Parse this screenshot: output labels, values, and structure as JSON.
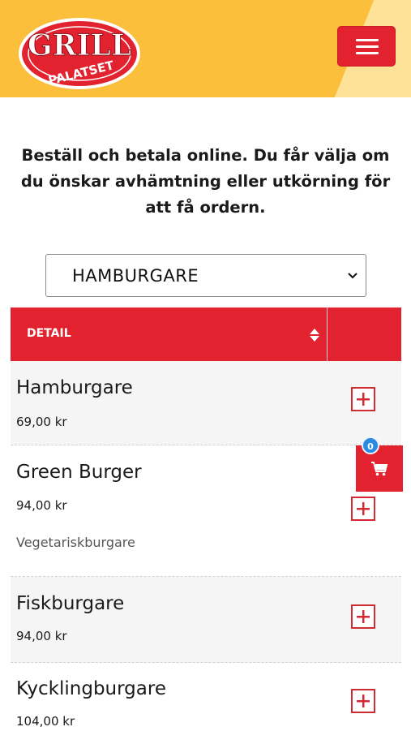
{
  "header": {
    "logo_top": "GRILL",
    "logo_bottom": "PALATSET",
    "menu_icon": "hamburger-menu-icon"
  },
  "intro_text": "Beställ och betala online. Du får välja om du önskar avhämtning eller utkörning för att få ordern.",
  "category_select": {
    "value": "HAMBURGARE",
    "icon": "chevron-down-icon"
  },
  "table": {
    "column_detail": "DETAIL",
    "sort_icon": "sort-icon",
    "items": [
      {
        "name": "Hamburgare",
        "price": "69,00 kr",
        "description": ""
      },
      {
        "name": "Green Burger",
        "price": "94,00 kr",
        "description": "Vegetariskburgare"
      },
      {
        "name": "Fiskburgare",
        "price": "94,00 kr",
        "description": ""
      },
      {
        "name": "Kycklingburgare",
        "price": "104,00 kr",
        "description": ""
      }
    ],
    "add_icon": "plus-square-icon"
  },
  "cart": {
    "count": "0",
    "icon": "shopping-cart-icon"
  },
  "colors": {
    "header_bg": "#fbbf3b",
    "accent_red": "#e2232f",
    "badge_blue": "#2a8be0"
  }
}
